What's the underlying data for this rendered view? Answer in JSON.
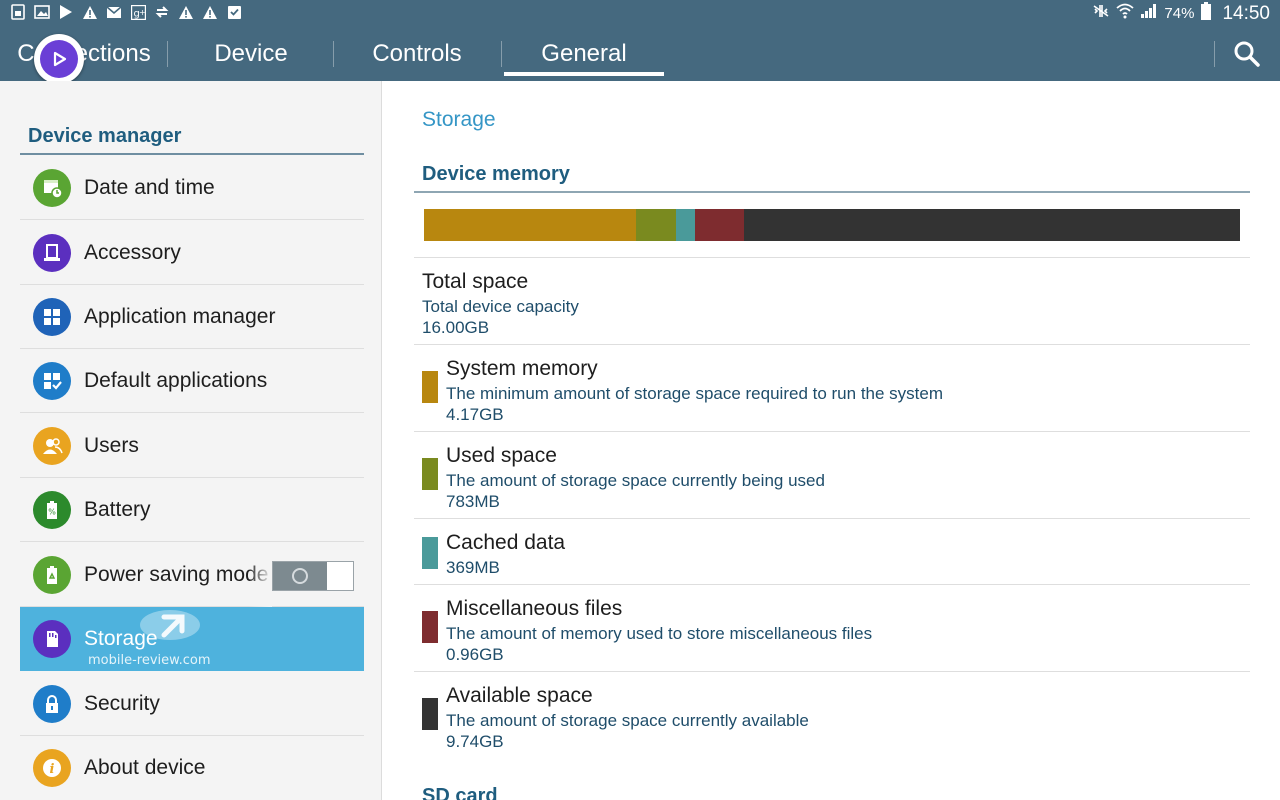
{
  "status_bar": {
    "left_icons": [
      "sim-icon",
      "gallery-icon",
      "play-store-icon",
      "warning-icon",
      "gmail-icon",
      "google-plus-icon",
      "sync-icon",
      "warning-icon",
      "warning-icon",
      "clipboard-icon"
    ],
    "battery_percent": "74%",
    "time": "14:50"
  },
  "tabs": [
    {
      "label": "Connections"
    },
    {
      "label": "Device"
    },
    {
      "label": "Controls"
    },
    {
      "label": "General",
      "active": true
    }
  ],
  "sidebar": {
    "header": "Device manager",
    "items": [
      {
        "label": "Date and time",
        "icon": "calendar-clock-icon",
        "color": "#5aa533"
      },
      {
        "label": "Accessory",
        "icon": "accessory-icon",
        "color": "#5b2fbf"
      },
      {
        "label": "Application manager",
        "icon": "grid-icon",
        "color": "#1f63b8"
      },
      {
        "label": "Default applications",
        "icon": "grid-check-icon",
        "color": "#1f7dc9"
      },
      {
        "label": "Users",
        "icon": "users-icon",
        "color": "#e9a420"
      },
      {
        "label": "Battery",
        "icon": "battery-icon",
        "color": "#2c8a2c"
      },
      {
        "label": "Power saving mode",
        "icon": "recycle-icon",
        "color": "#5aa533",
        "toggle": "off"
      },
      {
        "label": "Storage",
        "icon": "sd-card-icon",
        "color": "#5b2fbf",
        "selected": true
      },
      {
        "label": "Security",
        "icon": "lock-icon",
        "color": "#1f7dc9"
      },
      {
        "label": "About device",
        "icon": "info-icon",
        "color": "#e9a420"
      }
    ],
    "watermark": "mobile-review.com"
  },
  "main": {
    "title": "Storage",
    "section_header": "Device memory",
    "rows": [
      {
        "title": "Total space",
        "desc": "Total device capacity",
        "value": "16.00GB"
      },
      {
        "title": "System memory",
        "desc": "The minimum amount of storage space required to run the system",
        "value": "4.17GB",
        "color": "#b8870f"
      },
      {
        "title": "Used space",
        "desc": "The amount of storage space currently being used",
        "value": "783MB",
        "color": "#7a8a1f"
      },
      {
        "title": "Cached data",
        "desc": "",
        "value": "369MB",
        "color": "#4a9a9a"
      },
      {
        "title": "Miscellaneous files",
        "desc": "The amount of memory used to store miscellaneous files",
        "value": "0.96GB",
        "color": "#7e2c2f"
      },
      {
        "title": "Available space",
        "desc": "The amount of storage space currently available",
        "value": "9.74GB",
        "color": "#333333"
      }
    ],
    "memory_bar": [
      {
        "name": "System memory",
        "fraction": 0.2606,
        "color": "#b8870f"
      },
      {
        "name": "Used space",
        "fraction": 0.0489,
        "color": "#7a8a1f"
      },
      {
        "name": "Cached data",
        "fraction": 0.0231,
        "color": "#4a9a9a"
      },
      {
        "name": "Miscellaneous files",
        "fraction": 0.06,
        "color": "#7e2c2f"
      },
      {
        "name": "Available space",
        "fraction": 0.6087,
        "color": "#333333"
      }
    ],
    "next_section": "SD card"
  }
}
